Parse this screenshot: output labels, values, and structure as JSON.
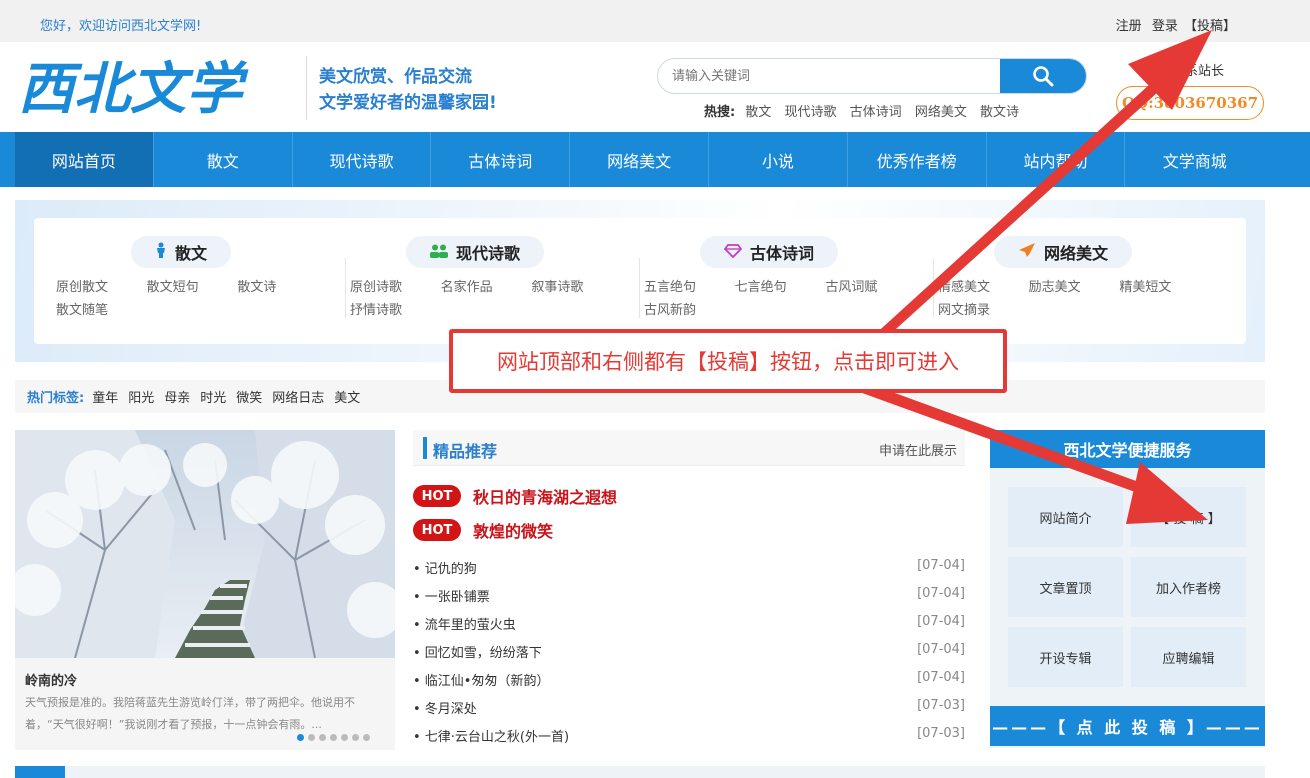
{
  "topbar": {
    "welcome": "您好，欢迎访问西北文学网!",
    "register": "注册",
    "login": "登录",
    "submit": "【投稿】"
  },
  "header": {
    "logo_text": "西北文学",
    "slogan_line1": "美文欣赏、作品交流",
    "slogan_line2": "文学爱好者的温馨家园!",
    "search_placeholder": "请输入关键词",
    "hot_label": "热搜:",
    "hot_items": [
      "散文",
      "现代诗歌",
      "古体诗词",
      "网络美文",
      "散文诗"
    ],
    "contact_label": "联系站长",
    "qq": "QQ:3803670367"
  },
  "nav": [
    "网站首页",
    "散文",
    "现代诗歌",
    "古体诗词",
    "网络美文",
    "小说",
    "优秀作者榜",
    "站内帮助",
    "文学商城"
  ],
  "categories": [
    {
      "title": "散文",
      "icon": "person-icon",
      "links": [
        "原创散文",
        "散文短句",
        "散文诗",
        "散文随笔"
      ]
    },
    {
      "title": "现代诗歌",
      "icon": "group-icon",
      "links": [
        "原创诗歌",
        "名家作品",
        "叙事诗歌",
        "抒情诗歌"
      ]
    },
    {
      "title": "古体诗词",
      "icon": "diamond-icon",
      "links": [
        "五言绝句",
        "七言绝句",
        "古风词赋",
        "古风新韵"
      ]
    },
    {
      "title": "网络美文",
      "icon": "paper-plane-icon",
      "links": [
        "情感美文",
        "励志美文",
        "精美短文",
        "网文摘录"
      ]
    }
  ],
  "tags": {
    "label": "热门标签:",
    "items": [
      "童年",
      "阳光",
      "母亲",
      "时光",
      "微笑",
      "网络日志",
      "美文"
    ]
  },
  "feature": {
    "title": "岭南的冷",
    "desc": "天气预报是准的。我陪蒋蓝先生游览岭仃洋，带了两把伞。他说用不着，“天气很好啊！”我说刚才看了预报，十一点钟会有雨。..."
  },
  "recommend": {
    "title": "精品推荐",
    "apply": "申请在此展示",
    "hot_badge": "HOT",
    "hot_items": [
      "秋日的青海湖之遐想",
      "敦煌的微笑"
    ],
    "list": [
      {
        "title": "• 记仇的狗",
        "date": "[07-04]"
      },
      {
        "title": "• 一张卧铺票",
        "date": "[07-04]"
      },
      {
        "title": "• 流年里的萤火虫",
        "date": "[07-04]"
      },
      {
        "title": "• 回忆如雪，纷纷落下",
        "date": "[07-04]"
      },
      {
        "title": "• 临江仙•匆匆（新韵）",
        "date": "[07-04]"
      },
      {
        "title": "• 冬月深处",
        "date": "[07-03]"
      },
      {
        "title": "• 七律·云台山之秋(外一首)",
        "date": "[07-03]"
      }
    ]
  },
  "service": {
    "title": "西北文学便捷服务",
    "items": [
      "网站简介",
      "【 投 稿 】",
      "文章置顶",
      "加入作者榜",
      "开设专辑",
      "应聘编辑"
    ],
    "submit_bar": "———【 点 此 投 稿 】———"
  },
  "annotation": {
    "callout": "网站顶部和右侧都有【投稿】按钮，点击即可进入"
  },
  "colors": {
    "primary": "#1a8ad8",
    "hot_red": "#d31414",
    "annotation_red": "#e53935",
    "qq_orange": "#f08a2a"
  }
}
